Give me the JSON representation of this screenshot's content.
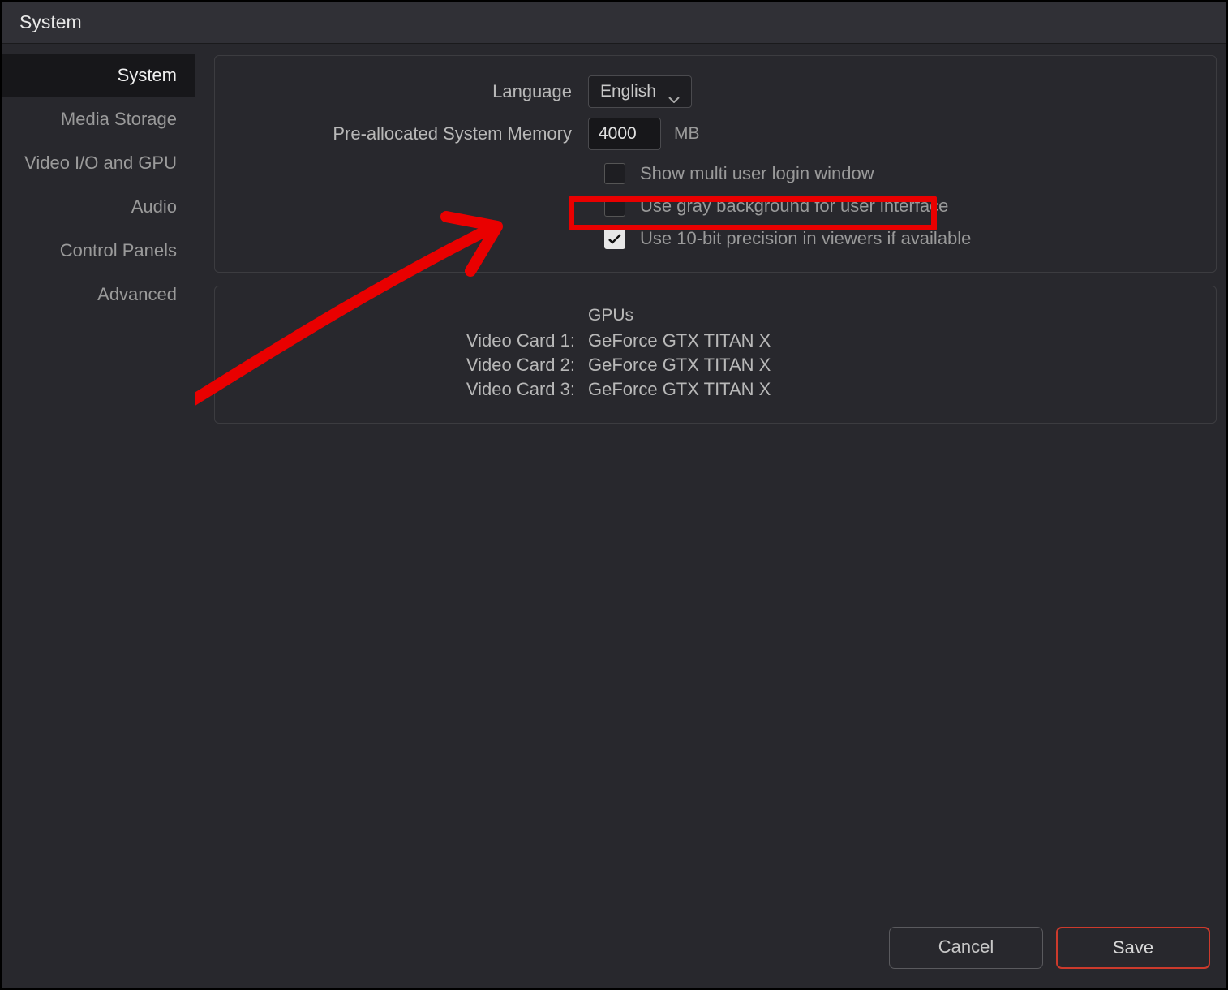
{
  "title": "System",
  "sidebar": {
    "items": [
      {
        "label": "System",
        "active": true
      },
      {
        "label": "Media Storage",
        "active": false
      },
      {
        "label": "Video I/O and GPU",
        "active": false
      },
      {
        "label": "Audio",
        "active": false
      },
      {
        "label": "Control Panels",
        "active": false
      },
      {
        "label": "Advanced",
        "active": false
      }
    ]
  },
  "settings": {
    "language_label": "Language",
    "language_value": "English",
    "memory_label": "Pre-allocated System Memory",
    "memory_value": "4000",
    "memory_unit": "MB",
    "checkboxes": [
      {
        "label": "Show multi user login window",
        "checked": false
      },
      {
        "label": "Use gray background for user interface",
        "checked": false
      },
      {
        "label": "Use 10-bit precision in viewers if available",
        "checked": true
      }
    ]
  },
  "gpu": {
    "header": "GPUs",
    "cards": [
      {
        "label": "Video Card 1:",
        "value": "GeForce GTX TITAN X"
      },
      {
        "label": "Video Card 2:",
        "value": "GeForce GTX TITAN X"
      },
      {
        "label": "Video Card 3:",
        "value": "GeForce GTX TITAN X"
      }
    ]
  },
  "footer": {
    "cancel": "Cancel",
    "save": "Save"
  },
  "annotation": {
    "type": "highlight-box-with-arrow",
    "target": "Use 10-bit precision in viewers if available"
  }
}
